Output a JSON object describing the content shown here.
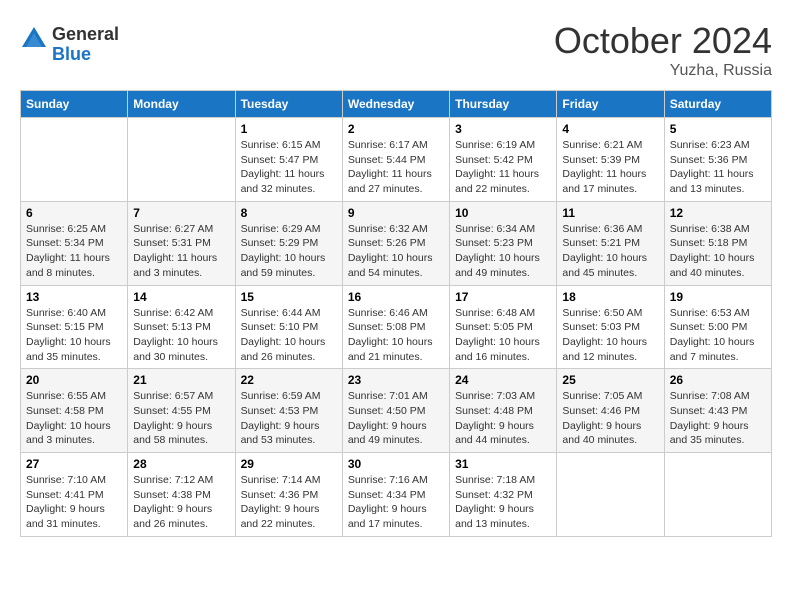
{
  "header": {
    "logo_general": "General",
    "logo_blue": "Blue",
    "title": "October 2024",
    "location": "Yuzha, Russia"
  },
  "weekdays": [
    "Sunday",
    "Monday",
    "Tuesday",
    "Wednesday",
    "Thursday",
    "Friday",
    "Saturday"
  ],
  "weeks": [
    [
      {
        "day": "",
        "info": ""
      },
      {
        "day": "",
        "info": ""
      },
      {
        "day": "1",
        "info": "Sunrise: 6:15 AM\nSunset: 5:47 PM\nDaylight: 11 hours and 32 minutes."
      },
      {
        "day": "2",
        "info": "Sunrise: 6:17 AM\nSunset: 5:44 PM\nDaylight: 11 hours and 27 minutes."
      },
      {
        "day": "3",
        "info": "Sunrise: 6:19 AM\nSunset: 5:42 PM\nDaylight: 11 hours and 22 minutes."
      },
      {
        "day": "4",
        "info": "Sunrise: 6:21 AM\nSunset: 5:39 PM\nDaylight: 11 hours and 17 minutes."
      },
      {
        "day": "5",
        "info": "Sunrise: 6:23 AM\nSunset: 5:36 PM\nDaylight: 11 hours and 13 minutes."
      }
    ],
    [
      {
        "day": "6",
        "info": "Sunrise: 6:25 AM\nSunset: 5:34 PM\nDaylight: 11 hours and 8 minutes."
      },
      {
        "day": "7",
        "info": "Sunrise: 6:27 AM\nSunset: 5:31 PM\nDaylight: 11 hours and 3 minutes."
      },
      {
        "day": "8",
        "info": "Sunrise: 6:29 AM\nSunset: 5:29 PM\nDaylight: 10 hours and 59 minutes."
      },
      {
        "day": "9",
        "info": "Sunrise: 6:32 AM\nSunset: 5:26 PM\nDaylight: 10 hours and 54 minutes."
      },
      {
        "day": "10",
        "info": "Sunrise: 6:34 AM\nSunset: 5:23 PM\nDaylight: 10 hours and 49 minutes."
      },
      {
        "day": "11",
        "info": "Sunrise: 6:36 AM\nSunset: 5:21 PM\nDaylight: 10 hours and 45 minutes."
      },
      {
        "day": "12",
        "info": "Sunrise: 6:38 AM\nSunset: 5:18 PM\nDaylight: 10 hours and 40 minutes."
      }
    ],
    [
      {
        "day": "13",
        "info": "Sunrise: 6:40 AM\nSunset: 5:15 PM\nDaylight: 10 hours and 35 minutes."
      },
      {
        "day": "14",
        "info": "Sunrise: 6:42 AM\nSunset: 5:13 PM\nDaylight: 10 hours and 30 minutes."
      },
      {
        "day": "15",
        "info": "Sunrise: 6:44 AM\nSunset: 5:10 PM\nDaylight: 10 hours and 26 minutes."
      },
      {
        "day": "16",
        "info": "Sunrise: 6:46 AM\nSunset: 5:08 PM\nDaylight: 10 hours and 21 minutes."
      },
      {
        "day": "17",
        "info": "Sunrise: 6:48 AM\nSunset: 5:05 PM\nDaylight: 10 hours and 16 minutes."
      },
      {
        "day": "18",
        "info": "Sunrise: 6:50 AM\nSunset: 5:03 PM\nDaylight: 10 hours and 12 minutes."
      },
      {
        "day": "19",
        "info": "Sunrise: 6:53 AM\nSunset: 5:00 PM\nDaylight: 10 hours and 7 minutes."
      }
    ],
    [
      {
        "day": "20",
        "info": "Sunrise: 6:55 AM\nSunset: 4:58 PM\nDaylight: 10 hours and 3 minutes."
      },
      {
        "day": "21",
        "info": "Sunrise: 6:57 AM\nSunset: 4:55 PM\nDaylight: 9 hours and 58 minutes."
      },
      {
        "day": "22",
        "info": "Sunrise: 6:59 AM\nSunset: 4:53 PM\nDaylight: 9 hours and 53 minutes."
      },
      {
        "day": "23",
        "info": "Sunrise: 7:01 AM\nSunset: 4:50 PM\nDaylight: 9 hours and 49 minutes."
      },
      {
        "day": "24",
        "info": "Sunrise: 7:03 AM\nSunset: 4:48 PM\nDaylight: 9 hours and 44 minutes."
      },
      {
        "day": "25",
        "info": "Sunrise: 7:05 AM\nSunset: 4:46 PM\nDaylight: 9 hours and 40 minutes."
      },
      {
        "day": "26",
        "info": "Sunrise: 7:08 AM\nSunset: 4:43 PM\nDaylight: 9 hours and 35 minutes."
      }
    ],
    [
      {
        "day": "27",
        "info": "Sunrise: 7:10 AM\nSunset: 4:41 PM\nDaylight: 9 hours and 31 minutes."
      },
      {
        "day": "28",
        "info": "Sunrise: 7:12 AM\nSunset: 4:38 PM\nDaylight: 9 hours and 26 minutes."
      },
      {
        "day": "29",
        "info": "Sunrise: 7:14 AM\nSunset: 4:36 PM\nDaylight: 9 hours and 22 minutes."
      },
      {
        "day": "30",
        "info": "Sunrise: 7:16 AM\nSunset: 4:34 PM\nDaylight: 9 hours and 17 minutes."
      },
      {
        "day": "31",
        "info": "Sunrise: 7:18 AM\nSunset: 4:32 PM\nDaylight: 9 hours and 13 minutes."
      },
      {
        "day": "",
        "info": ""
      },
      {
        "day": "",
        "info": ""
      }
    ]
  ]
}
